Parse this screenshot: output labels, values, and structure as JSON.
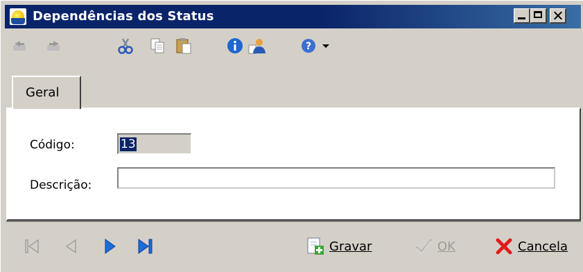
{
  "window": {
    "title": "Dependências dos Status",
    "icon": "app-sun-icon"
  },
  "toolbar": {
    "icons": [
      "undo-disabled-icon",
      "redo-disabled-icon",
      "cut-icon",
      "copy-icon",
      "paste-icon",
      "info-icon",
      "user-doc-icon",
      "help-icon",
      "dropdown-arrow-icon"
    ]
  },
  "tabs": [
    {
      "label": "Geral",
      "active": true
    }
  ],
  "form": {
    "codigo_label": "Código:",
    "codigo_value": "13",
    "descricao_label": "Descrição:",
    "descricao_value": ""
  },
  "navigation": {
    "icons": [
      "first-record-icon",
      "previous-record-icon",
      "next-record-icon",
      "last-record-icon"
    ]
  },
  "actions": {
    "gravar_label": "Gravar",
    "ok_label": "OK",
    "cancela_label": "Cancela"
  },
  "colors": {
    "titlebar": "#0a246a",
    "nav_active": "#1e6cd6",
    "cancel_red": "#e11b1b"
  }
}
